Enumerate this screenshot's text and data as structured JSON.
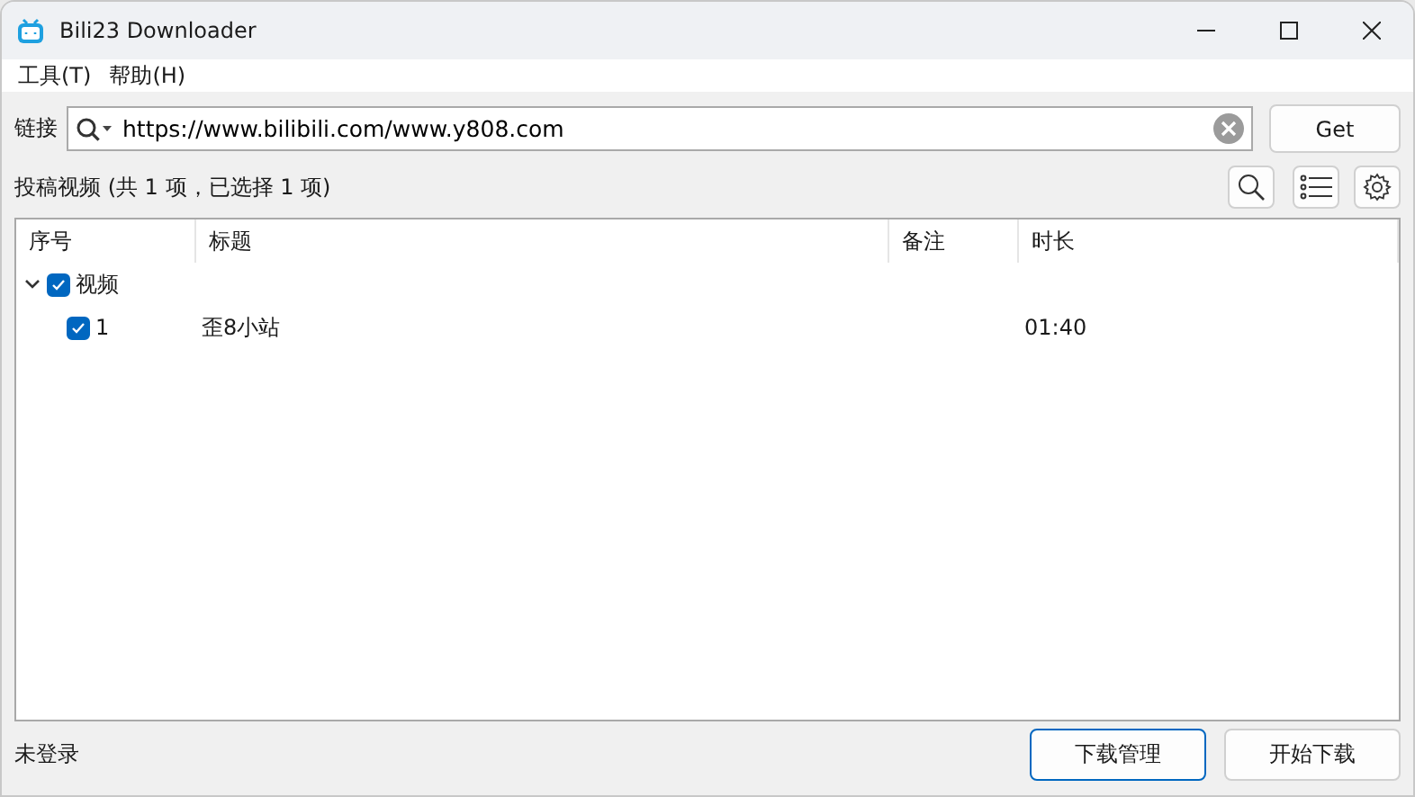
{
  "window": {
    "title": "Bili23 Downloader"
  },
  "menu": [
    "工具(T)",
    "帮助(H)"
  ],
  "link": {
    "label": "链接",
    "value": "https://www.bilibili.com/www.y808.com",
    "button": "Get"
  },
  "summary": "投稿视频 (共 1 项，已选择 1 项)",
  "table": {
    "columns": [
      "序号",
      "标题",
      "备注",
      "时长"
    ],
    "groups": [
      {
        "label": "视频",
        "expanded": true,
        "checked": true,
        "children": [
          {
            "number": "1",
            "title": "歪8小站",
            "duration": "01:40",
            "checked": true
          }
        ]
      }
    ]
  },
  "status": "未登录",
  "buttons": [
    {
      "label": "下载管理",
      "selected": true
    },
    {
      "label": "开始下载",
      "selected": false
    }
  ]
}
